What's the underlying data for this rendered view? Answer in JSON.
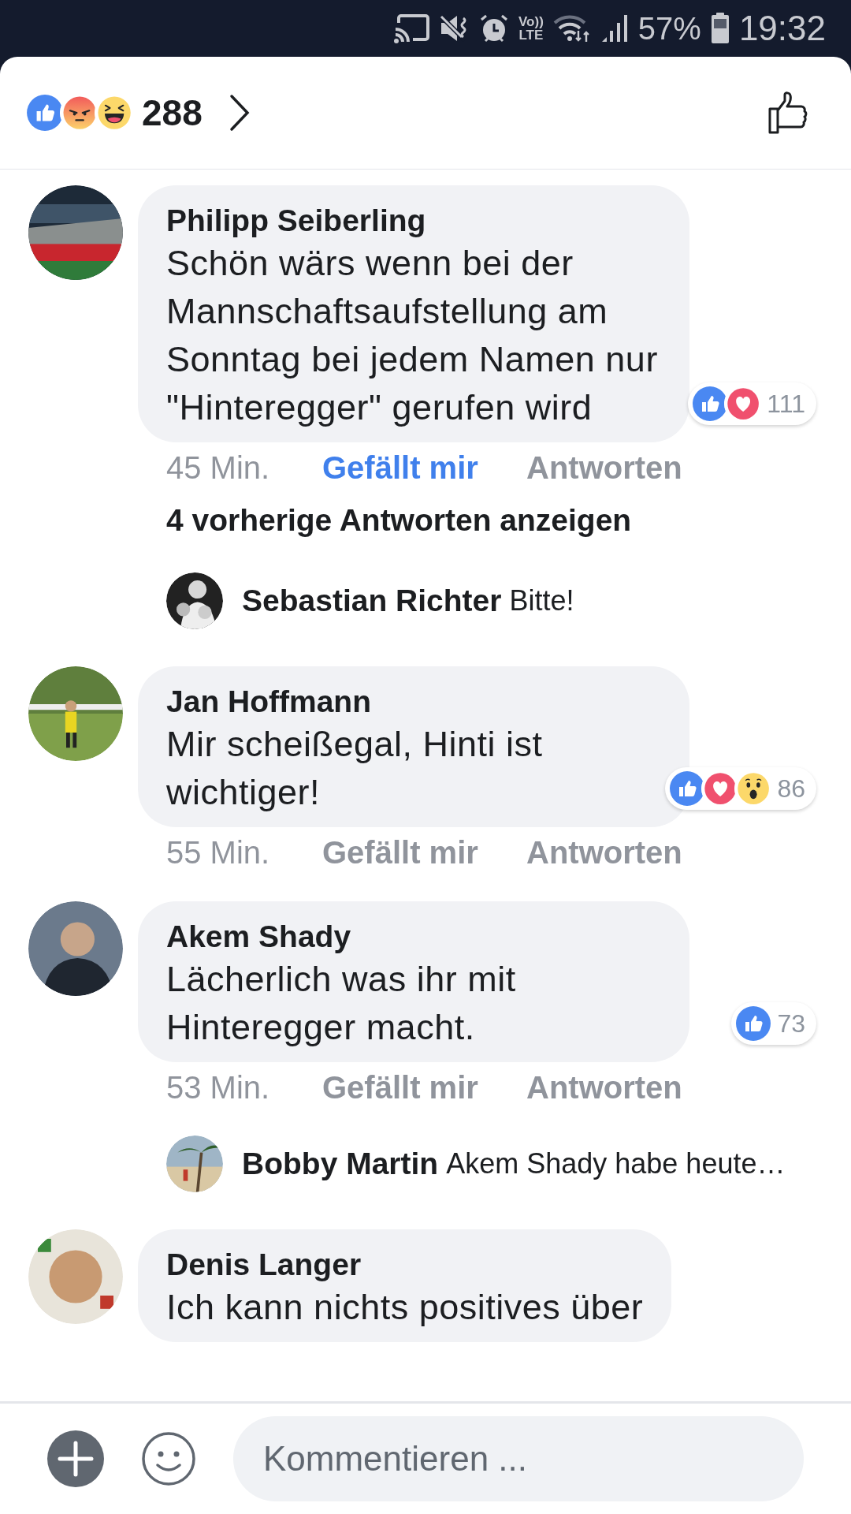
{
  "status_bar": {
    "network_label": [
      "Vo))",
      "LTE"
    ],
    "battery": "57%",
    "time": "19:32"
  },
  "reactions_summary": {
    "reactions": [
      {
        "kind": "like"
      },
      {
        "kind": "angry"
      },
      {
        "kind": "haha"
      }
    ],
    "count": "288"
  },
  "comments": [
    {
      "author": "Philipp Seiberling",
      "text": "Schön wärs wenn bei der Mannschaftsaufstellung am Sonntag bei jedem Namen nur \"Hinteregger\" gerufen wird",
      "reactions": [
        {
          "kind": "like"
        },
        {
          "kind": "love"
        }
      ],
      "reaction_count": "111",
      "time": "45 Min.",
      "like_label": "Gefällt mir",
      "liked": true,
      "reply_label": "Antworten",
      "more_replies": "4 vorherige Antworten anzeigen",
      "replies": [
        {
          "author": "Sebastian Richter",
          "text": "Bitte!"
        }
      ]
    },
    {
      "author": "Jan Hoffmann",
      "text": "Mir scheißegal, Hinti ist wichtiger!",
      "reactions": [
        {
          "kind": "like"
        },
        {
          "kind": "love"
        },
        {
          "kind": "wow"
        }
      ],
      "reaction_count": "86",
      "time": "55 Min.",
      "like_label": "Gefällt mir",
      "liked": false,
      "reply_label": "Antworten"
    },
    {
      "author": "Akem Shady",
      "text": "Lächerlich was ihr mit Hinteregger macht.",
      "reactions": [
        {
          "kind": "like"
        }
      ],
      "reaction_count": "73",
      "time": "53 Min.",
      "like_label": "Gefällt mir",
      "liked": false,
      "reply_label": "Antworten",
      "replies": [
        {
          "author": "Bobby Martin",
          "text": "Akem Shady habe heute…"
        }
      ]
    },
    {
      "author": "Denis Langer",
      "text": "Ich kann nichts positives über"
    }
  ],
  "composer": {
    "placeholder": "Kommentieren ..."
  }
}
